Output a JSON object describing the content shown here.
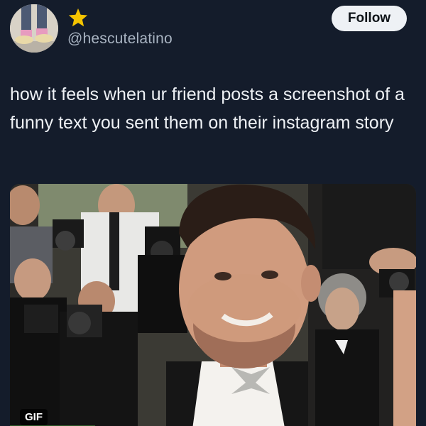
{
  "user": {
    "handle": "@hescutelatino",
    "badge_icon": "star-icon"
  },
  "actions": {
    "follow_label": "Follow"
  },
  "post": {
    "text": "how it feels when ur friend posts a screenshot of a funny text you sent them on their instagram story"
  },
  "media": {
    "badge_label": "GIF"
  },
  "colors": {
    "background": "#141c2b",
    "star": "#f5c400",
    "follow_bg": "#eef1f5"
  }
}
